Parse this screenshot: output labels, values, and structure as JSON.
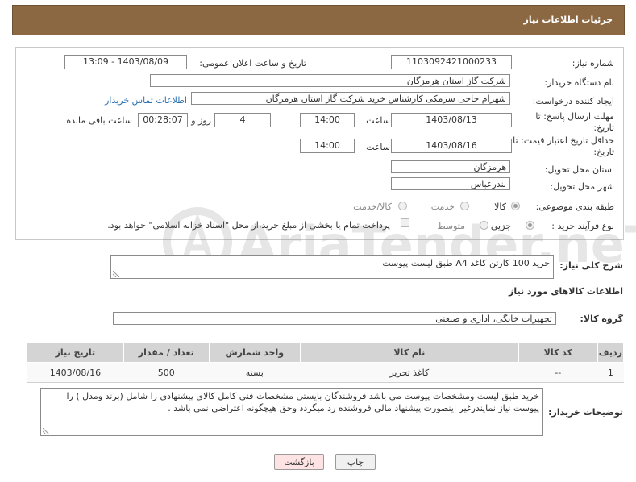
{
  "header": {
    "title": "جزئیات اطلاعات نیاز"
  },
  "form": {
    "need_number": {
      "label": "شماره نیاز:",
      "value": "1103092421000233"
    },
    "announce_datetime": {
      "label": "تاریخ و ساعت اعلان عمومی:",
      "value": "1403/08/09 - 13:09"
    },
    "buyer_org": {
      "label": "نام دستگاه خریدار:",
      "value": "شرکت گاز استان هرمزگان"
    },
    "requester": {
      "label": "ایجاد کننده درخواست:",
      "value": "شهرام حاجی سرمکی کارشناس خرید شرکت گاز استان هرمزگان",
      "contact_link": "اطلاعات تماس خریدار"
    },
    "send_deadline": {
      "label_line1": "مهلت ارسال پاسخ: تا",
      "label_line2": "تاریخ:",
      "date": "1403/08/13",
      "time_label": "ساعت",
      "time": "14:00",
      "days": "4",
      "days_label": "روز و",
      "remaining": "00:28:07",
      "remaining_label": "ساعت باقی مانده"
    },
    "price_validity": {
      "label_line1": "حداقل تاریخ اعتبار قیمت: تا",
      "label_line2": "تاریخ:",
      "date": "1403/08/16",
      "time_label": "ساعت",
      "time": "14:00"
    },
    "delivery_province": {
      "label": "استان محل تحویل:",
      "value": "هرمزگان"
    },
    "delivery_city": {
      "label": "شهر محل تحویل:",
      "value": "بندرعباس"
    },
    "category": {
      "label": "طبقه بندی موضوعی:",
      "options": [
        "کالا",
        "خدمت",
        "کالا/خدمت"
      ],
      "selected": "کالا"
    },
    "purchase_type": {
      "label": "نوع فرآیند خرید :",
      "options": [
        "جزیی",
        "متوسط"
      ],
      "selected": "جزیی",
      "checkbox_text": "پرداخت تمام یا بخشی از مبلغ خرید،از محل \"اسناد خزانه اسلامی\" خواهد بود."
    }
  },
  "description": {
    "label": "شرح کلی نیاز:",
    "value": "خرید 100 کارتن کاغذ A4 طبق لیست پیوست"
  },
  "goods_section": {
    "title": "اطلاعات کالاهای مورد نیاز"
  },
  "goods_group": {
    "label": "گروه کالا:",
    "value": "تجهیزات خانگی، اداری و صنعتی"
  },
  "table": {
    "headers": [
      "ردیف",
      "کد کالا",
      "نام کالا",
      "واحد شمارش",
      "تعداد / مقدار",
      "تاریخ نیاز"
    ],
    "rows": [
      [
        "1",
        "--",
        "کاغذ تحریر",
        "بسته",
        "500",
        "1403/08/16"
      ]
    ]
  },
  "buyer_notes": {
    "label": "توضیحات خریدار:",
    "value": "خرید طبق لیست ومشخصات پیوست می باشد فروشندگان بایستی مشخصات فنی کامل کالای پیشنهادی را شامل (برند ومدل ) را پیوست نیاز نمایندرغیر اینصورت پیشنهاد مالی فروشنده رد میگردد وحق هیچگونه اعتراضی نمی باشد ."
  },
  "buttons": {
    "print": "چاپ",
    "back": "بازگشت"
  },
  "watermark": {
    "text": "AriaTender.neT"
  },
  "colors": {
    "header_bg": "#8b6842",
    "link": "#2a6fb0",
    "back_button_bg": "#fde3e3"
  }
}
